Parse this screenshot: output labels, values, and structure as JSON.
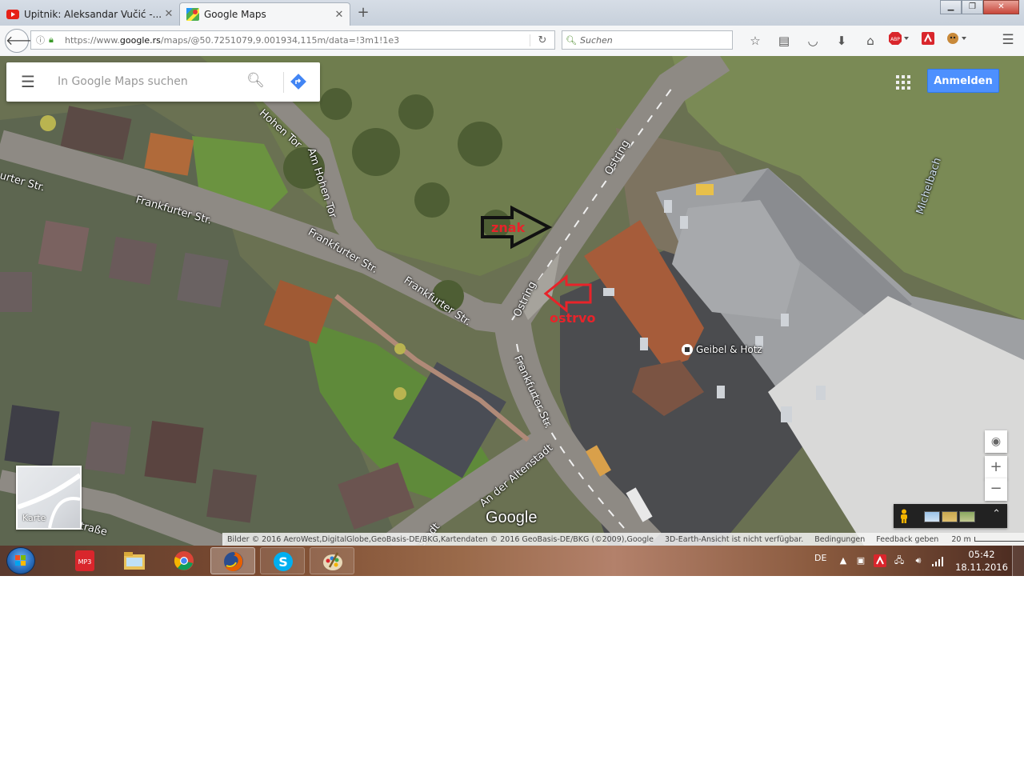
{
  "browser": {
    "tabs": [
      {
        "title": "Upitnik: Aleksandar Vučić -...",
        "icon": "youtube-icon",
        "active": false
      },
      {
        "title": "Google Maps",
        "icon": "google-maps-icon",
        "active": true
      }
    ],
    "new_tab_label": "+",
    "url": {
      "prefix": "https://www.",
      "domain": "google.rs",
      "path": "/maps/@50.7251079,9.001934,115m/data=!3m1!1e3"
    },
    "search_placeholder": "Suchen"
  },
  "maps": {
    "search_placeholder": "In Google Maps suchen",
    "signin_label": "Anmelden",
    "street_labels": {
      "frankfurter_1": "urter Str.",
      "frankfurter_2": "Frankfurter Str.",
      "frankfurter_3": "Frankfurter Str.",
      "frankfurter_4": "Frankfurter Str.",
      "frankfurter_5": "Frankfurter Str.",
      "hohen_tor_1": "Hohen Tor",
      "hohen_tor_2": "Am Hohen Tor",
      "ostring_1": "Ostring",
      "ostring_2": "Ostring",
      "michelbach": "Michelbach",
      "altenstadt_1": "An der Altenstadt",
      "altenstadt_2": "stadt",
      "strasse": "traße"
    },
    "annotations": {
      "sign_label": "znak",
      "island_label": "ostrvo"
    },
    "poi_label": "Geibel & Hotz",
    "logo": "Google",
    "minimap_label": "Karte",
    "zoom_in": "+",
    "zoom_out": "−",
    "footer": {
      "attribution": "Bilder © 2016 AeroWest,DigitalGlobe,GeoBasis-DE/BKG,Kartendaten © 2016 GeoBasis-DE/BKG (©2009),Google",
      "earth": "3D-Earth-Ansicht ist nicht verfügbar.",
      "terms": "Bedingungen",
      "feedback": "Feedback geben",
      "scale": "20 m"
    }
  },
  "taskbar": {
    "language": "DE",
    "time": "05:42",
    "date": "18.11.2016",
    "apps": [
      "mp3-converter-icon",
      "file-explorer-icon",
      "chrome-icon",
      "firefox-icon",
      "skype-icon",
      "paint-icon"
    ]
  },
  "colors": {
    "annotation_red": "#e8232a",
    "annotation_black": "#111111",
    "signin_blue": "#4d90fe"
  }
}
